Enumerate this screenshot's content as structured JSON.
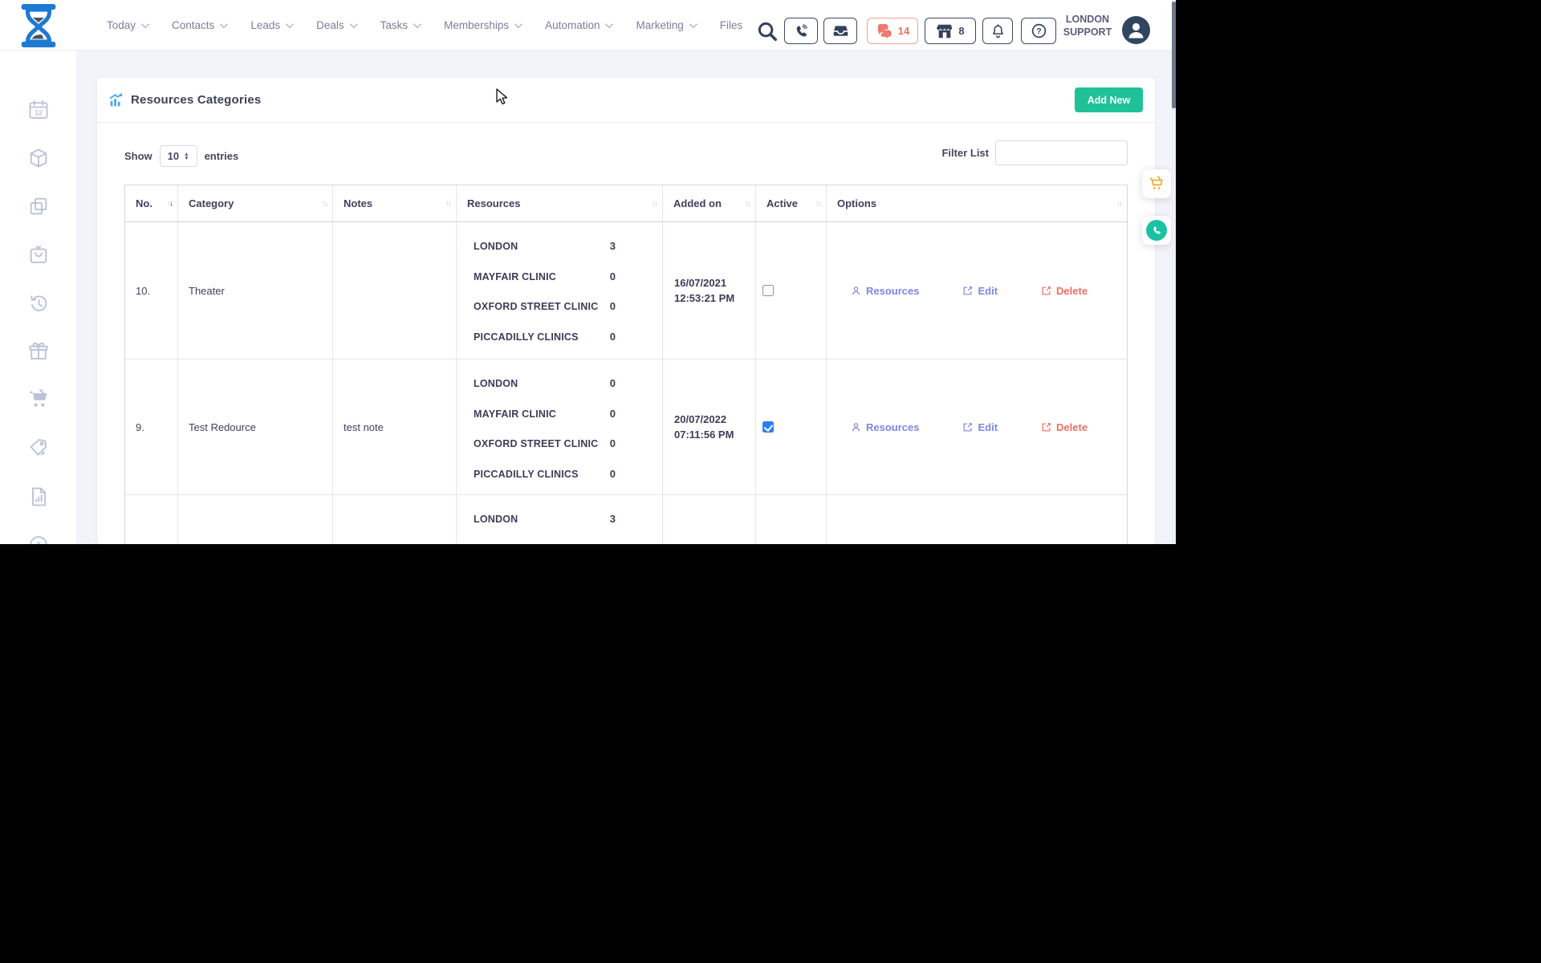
{
  "topbar": {
    "nav": [
      {
        "label": "Today",
        "chevron": true
      },
      {
        "label": "Contacts",
        "chevron": true
      },
      {
        "label": "Leads",
        "chevron": true
      },
      {
        "label": "Deals",
        "chevron": true
      },
      {
        "label": "Tasks",
        "chevron": true
      },
      {
        "label": "Memberships",
        "chevron": true
      },
      {
        "label": "Automation",
        "chevron": true
      },
      {
        "label": "Marketing",
        "chevron": true
      },
      {
        "label": "Files",
        "chevron": false
      }
    ],
    "actions": {
      "search_icon": "search-icon",
      "phone_icon": "phone-icon",
      "inbox_icon": "inbox-icon",
      "chat_icon": "chat-bubbles-icon",
      "chat_count": "14",
      "store_icon": "storefront-icon",
      "store_count": "8",
      "bell_icon": "bell-icon",
      "help_icon": "question-mark-icon"
    },
    "user": {
      "line1": "LONDON",
      "line2": "SUPPORT",
      "avatar_icon": "person-icon"
    }
  },
  "sidebar": {
    "icons": [
      "calendar-12-icon",
      "package-icon",
      "copy-icon",
      "bag-icon",
      "history-icon",
      "gift-icon",
      "cart-icon",
      "tag-icon",
      "report-icon",
      "circle-partial-icon"
    ]
  },
  "page": {
    "title": "Resources Categories",
    "title_icon": "bar-chart-trend-icon",
    "add_new_label": "Add New",
    "show_label": "Show",
    "page_size": "10",
    "entries_label": "entries",
    "filter_label": "Filter List",
    "filter_value": ""
  },
  "table": {
    "columns": [
      "No.",
      "Category",
      "Notes",
      "Resources",
      "Added on",
      "Active",
      "Options"
    ],
    "sort_state": "No. descending",
    "options_labels": {
      "resources": "Resources",
      "edit": "Edit",
      "delete": "Delete"
    },
    "rows": [
      {
        "no": "10.",
        "category": "Theater",
        "notes": "",
        "resources": [
          {
            "name": "LONDON",
            "count": "3"
          },
          {
            "name": "MAYFAIR CLINIC",
            "count": "0"
          },
          {
            "name": "OXFORD STREET CLINIC",
            "count": "0"
          },
          {
            "name": "PICCADILLY CLINICS",
            "count": "0"
          }
        ],
        "added_date": "16/07/2021",
        "added_time": "12:53:21 PM",
        "active": false
      },
      {
        "no": "9.",
        "category": "Test Redource",
        "notes": "test note",
        "resources": [
          {
            "name": "LONDON",
            "count": "0"
          },
          {
            "name": "MAYFAIR CLINIC",
            "count": "0"
          },
          {
            "name": "OXFORD STREET CLINIC",
            "count": "0"
          },
          {
            "name": "PICCADILLY CLINICS",
            "count": "0"
          }
        ],
        "added_date": "20/07/2022",
        "added_time": "07:11:56 PM",
        "active": true
      },
      {
        "no": "",
        "category": "",
        "notes": "",
        "resources": [
          {
            "name": "LONDON",
            "count": "3"
          }
        ],
        "added_date": "",
        "added_time": "",
        "active": null
      }
    ]
  },
  "colors": {
    "navy": "#3b4a63",
    "salmon": "#ee6e62",
    "periwinkle": "#7c87e4",
    "green": "#1fc298",
    "accent_blue": "#4aa8ef",
    "checkbox_blue": "#2c7ef5",
    "bg": "#f3f4f9"
  }
}
